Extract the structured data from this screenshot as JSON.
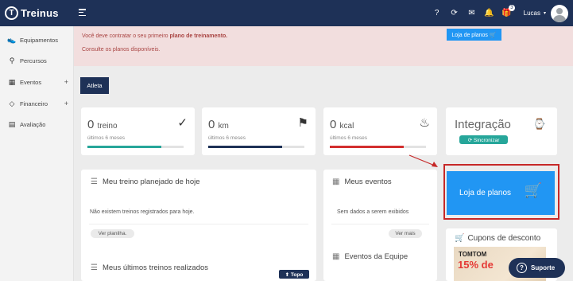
{
  "brand": {
    "logo_glyph": "T",
    "name": "Treinus"
  },
  "topbar": {
    "icons": [
      {
        "name": "help-icon",
        "glyph": "?"
      },
      {
        "name": "sync-icon",
        "glyph": "⟳"
      },
      {
        "name": "mail-icon",
        "glyph": "✉"
      },
      {
        "name": "bell-icon",
        "glyph": "🔔"
      },
      {
        "name": "gift-icon",
        "glyph": "🎁",
        "badge": "3"
      }
    ],
    "user_name": "Lucas",
    "caret": "▾"
  },
  "sidebar": {
    "items": [
      {
        "label": "Equipamentos",
        "icon": "shoe-icon",
        "glyph": "👟"
      },
      {
        "label": "Percursos",
        "icon": "route-icon",
        "glyph": "⚲"
      },
      {
        "label": "Eventos",
        "icon": "calendar-icon",
        "glyph": "▦",
        "plus": "+"
      },
      {
        "label": "Financeiro",
        "icon": "tag-icon",
        "glyph": "◇",
        "plus": "+"
      },
      {
        "label": "Avaliação",
        "icon": "assessment-icon",
        "glyph": "▤"
      }
    ]
  },
  "alert": {
    "line1_prefix": "Você deve contratar o seu primeiro ",
    "line1_bold": "plano de treinamento.",
    "line2": "Consulte os planos disponíveis.",
    "shop_button": "Loja de planos 🛒"
  },
  "tabs": {
    "atleta": "Atleta"
  },
  "stats": [
    {
      "value": "0",
      "unit": "treino",
      "sub": "últimos 6 meses",
      "icon": "check-circle-icon",
      "glyph": "✓",
      "color": "#26a69a",
      "progress": 0.77
    },
    {
      "value": "0",
      "unit": "km",
      "sub": "últimos 6 meses",
      "icon": "signpost-icon",
      "glyph": "⚑",
      "color": "#1e3157",
      "progress": 0.77
    },
    {
      "value": "0",
      "unit": "kcal",
      "sub": "últimos 6 meses",
      "icon": "flame-icon",
      "glyph": "♨",
      "color": "#d32f2f",
      "progress": 0.77
    }
  ],
  "integracao": {
    "title": "Integração",
    "icon_glyph": "⌚",
    "sync_button": "⟳ Sincronizar"
  },
  "treino_hoje": {
    "title": "Meu treino planejado de hoje",
    "empty": "Não existem treinos registrados para hoje.",
    "button": "Ver planilha."
  },
  "eventos": {
    "title": "Meus eventos",
    "empty": "Sem dados a serem exibidos",
    "button": "Ver mais",
    "team_title": "Eventos da Equipe"
  },
  "shop_big": {
    "label": "Loja de planos",
    "cart": "🛒"
  },
  "cupons": {
    "title": "Cupons de desconto",
    "promo_brand": "TOMTOM",
    "promo_off": "15% de"
  },
  "ultimos": {
    "title": "Meus últimos treinos realizados"
  },
  "topo_button": "⬆ Topo",
  "suporte_button": "Suporte",
  "colors": {
    "navy": "#1e3157",
    "blue": "#2196f3",
    "teal": "#26a69a",
    "red": "#d32f2f",
    "alert_bg": "#f2dede"
  }
}
